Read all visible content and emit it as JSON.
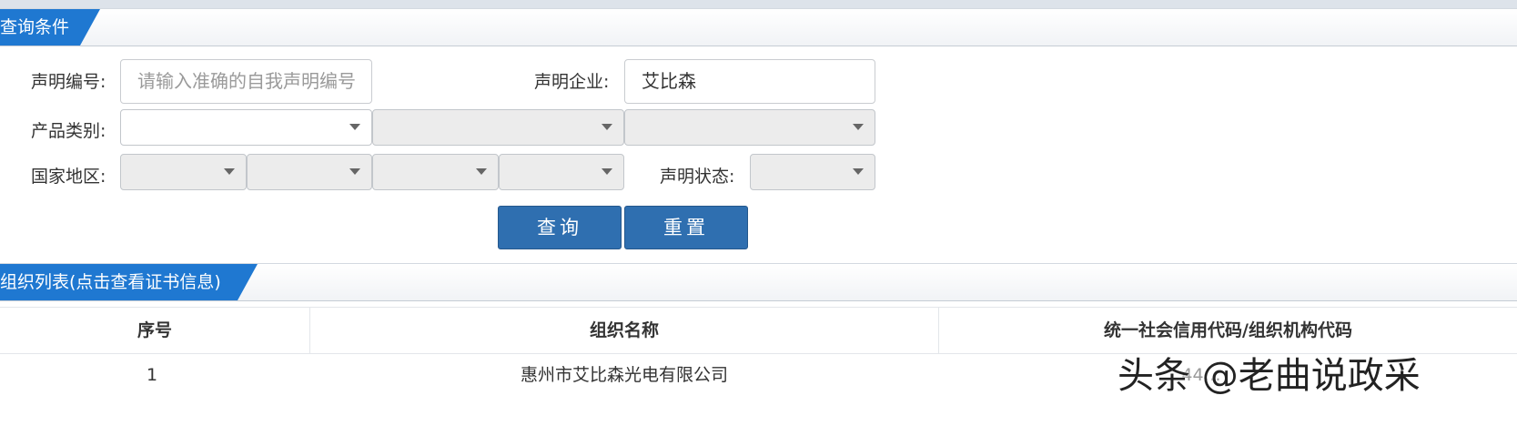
{
  "query_panel": {
    "title": "查询条件",
    "declaration_no_label": "声明编号:",
    "declaration_no_placeholder": "请输入准确的自我声明编号",
    "enterprise_label": "声明企业:",
    "enterprise_value": "艾比森",
    "product_category_label": "产品类别:",
    "region_label": "国家地区:",
    "status_label": "声明状态:",
    "query_button": "查询",
    "reset_button": "重置"
  },
  "list_panel": {
    "title": "组织列表(点击查看证书信息)",
    "columns": [
      "序号",
      "组织名称",
      "统一社会信用代码/组织机构代码"
    ],
    "rows": [
      {
        "index": "1",
        "name": "惠州市艾比森光电有限公司",
        "code": "44…"
      }
    ]
  },
  "watermark": "头条 @老曲说政采",
  "colors": {
    "tab_blue": "#1f78d1",
    "button_blue": "#2f6fb0"
  }
}
